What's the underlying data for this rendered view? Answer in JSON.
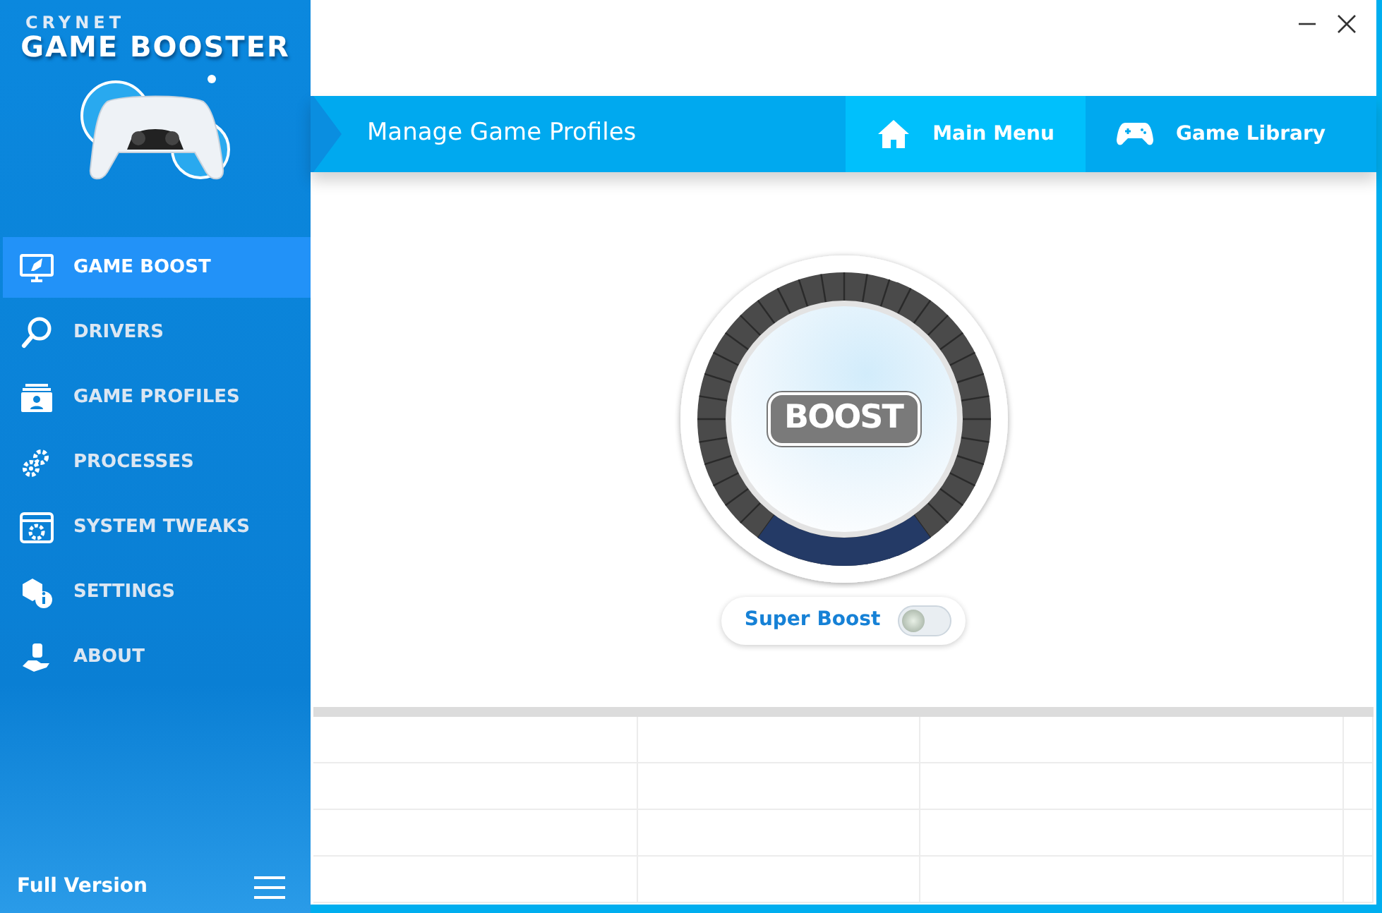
{
  "brand": {
    "maker": "CRYNET",
    "title": "GAME BOOSTER"
  },
  "sidebar": {
    "items": [
      {
        "label": "GAME BOOST",
        "selected": true
      },
      {
        "label": "DRIVERS",
        "selected": false
      },
      {
        "label": "GAME PROFILES",
        "selected": false
      },
      {
        "label": "PROCESSES",
        "selected": false
      },
      {
        "label": "SYSTEM TWEAKS",
        "selected": false
      },
      {
        "label": "SETTINGS",
        "selected": false
      },
      {
        "label": "ABOUT",
        "selected": false
      }
    ],
    "footer": "Full Version"
  },
  "header": {
    "title": "Manage Game Profiles",
    "tabs": [
      {
        "label": "Main Menu",
        "selected": true
      },
      {
        "label": "Game Library",
        "selected": false
      }
    ]
  },
  "boost": {
    "label": "BOOST"
  },
  "super_boost": {
    "label": "Super Boost",
    "on": false
  }
}
